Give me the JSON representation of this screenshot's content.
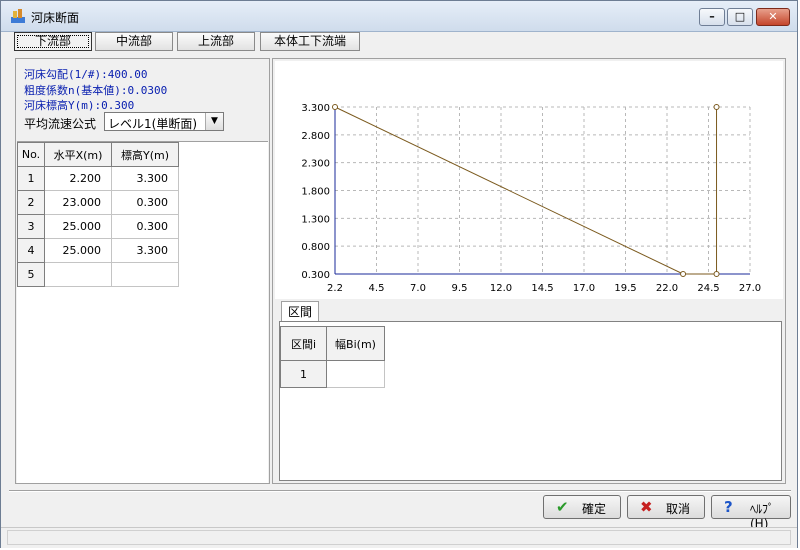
{
  "window": {
    "title": "河床断面"
  },
  "tabs": [
    "下流部",
    "中流部",
    "上流部",
    "本体工下流端"
  ],
  "info": {
    "gradient": "河床勾配(1/#):400.00",
    "roughness": "粗度係数n(基本値):0.0300",
    "bed_elevation": "河床標高Y(m):0.300",
    "formula_label": "平均流速公式",
    "formula_value": "レベル1(単断面)"
  },
  "grid": {
    "headers": [
      "No.",
      "水平X(m)",
      "標高Y(m)"
    ],
    "rows": [
      {
        "no": "1",
        "x": "2.200",
        "y": "3.300"
      },
      {
        "no": "2",
        "x": "23.000",
        "y": "0.300"
      },
      {
        "no": "3",
        "x": "25.000",
        "y": "0.300"
      },
      {
        "no": "4",
        "x": "25.000",
        "y": "3.300"
      },
      {
        "no": "5",
        "x": "",
        "y": ""
      }
    ]
  },
  "chart_data": {
    "type": "line",
    "x_ticks": [
      "2.2",
      "4.5",
      "7.0",
      "9.5",
      "12.0",
      "14.5",
      "17.0",
      "19.5",
      "22.0",
      "24.5",
      "27.0"
    ],
    "y_ticks": [
      "3.300",
      "2.800",
      "2.300",
      "1.800",
      "1.300",
      "0.800",
      "0.300"
    ],
    "xlim": [
      2.2,
      27.0
    ],
    "ylim": [
      0.3,
      3.3
    ],
    "grid": true,
    "series": [
      {
        "points": [
          [
            2.2,
            3.3
          ],
          [
            23.0,
            0.3
          ],
          [
            25.0,
            0.3
          ],
          [
            25.0,
            3.3
          ]
        ],
        "color": "#7b5a1e"
      }
    ]
  },
  "section": {
    "tab_label": "区間",
    "headers": [
      "区間i",
      "幅Bi(m)"
    ],
    "rows": [
      {
        "i": "1",
        "width": ""
      }
    ]
  },
  "buttons": {
    "ok": {
      "icon": "check-icon",
      "label": "確定"
    },
    "cancel": {
      "icon": "x-icon",
      "label": "取消"
    },
    "help": {
      "icon": "question-icon",
      "label": "ﾍﾙﾌﾟ(H)"
    }
  },
  "colors": {
    "info_text": "#0a20b0",
    "plot_line": "#7b5a1e",
    "axis": "#1a2a9a"
  }
}
